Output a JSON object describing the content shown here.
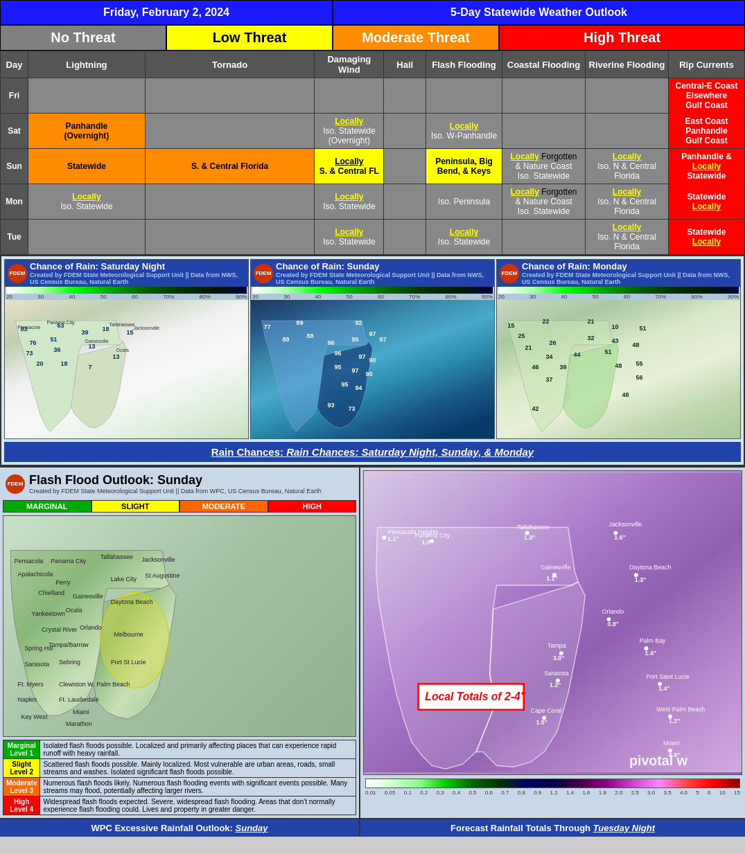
{
  "header": {
    "date": "Friday, February 2, 2024",
    "outlook": "5-Day Statewide Weather Outlook"
  },
  "threats": {
    "no_threat": "No Threat",
    "low_threat": "Low Threat",
    "moderate_threat": "Moderate Threat",
    "high_threat": "High Threat"
  },
  "columns": {
    "day": "Day",
    "lightning": "Lightning",
    "tornado": "Tornado",
    "damaging_wind": "Damaging Wind",
    "hail": "Hail",
    "flash_flooding": "Flash Flooding",
    "coastal_flooding": "Coastal Flooding",
    "riverine_flooding": "Riverine Flooding",
    "rip_currents": "Rip Currents"
  },
  "rows": [
    {
      "day": "Fri",
      "lightning": "",
      "tornado": "",
      "damaging_wind": "",
      "hail": "",
      "flash_flooding": "",
      "coastal_flooding": "",
      "riverine_flooding": "",
      "rip_currents_line1": "Central-E Coast",
      "rip_currents_line2": "Elsewhere",
      "rip_currents_line3": "Gulf Coast",
      "rip_type": "red"
    },
    {
      "day": "Sat",
      "lightning_locally": "Panhandle (Overnight)",
      "lightning_type": "orange",
      "tornado": "",
      "damaging_wind_locally": "Locally",
      "damaging_wind_sub": "Iso. Statewide (Overnight)",
      "hail": "",
      "flash_locally": "Locally",
      "flash_sub": "Iso. W-Panhandle",
      "coastal_flooding": "",
      "riverine_flooding": "",
      "rip_currents_line1": "East Coast",
      "rip_currents_line2": "Panhandle",
      "rip_currents_line3": "Gulf Coast",
      "rip_type": "red"
    },
    {
      "day": "Sun",
      "lightning": "Statewide",
      "lightning_type": "orange",
      "tornado_locally": "S. & Central Florida",
      "tornado_type": "orange",
      "damaging_wind_locally": "Locally",
      "damaging_wind_sub": "S. & Central FL",
      "hail": "",
      "flash_flooding": "Peninsula, Big Bend, & Keys",
      "flash_type": "yellow",
      "coastal_locally": "Locally Forgotten & Nature Coast",
      "coastal_sub": "Iso. Statewide",
      "riverine_locally": "Locally",
      "riverine_sub": "Iso. N & Central Florida",
      "rip_currents_line1": "Panhandle &",
      "rip_currents_line2": "Locally",
      "rip_currents_line3": "Statewide",
      "rip_type": "red"
    },
    {
      "day": "Mon",
      "lightning_locally": "Locally",
      "lightning_sub": "Iso. Statewide",
      "lightning_type": "yellow",
      "tornado": "",
      "damaging_wind_locally": "Locally",
      "damaging_wind_sub": "Iso. Statewide",
      "hail": "",
      "flash_flooding": "Iso. Peninsula",
      "flash_type": "gray",
      "coastal_locally": "Locally Forgotten & Nature Coast",
      "coastal_sub": "Iso. Statewide",
      "riverine_locally": "Locally",
      "riverine_sub": "Iso. N & Central Florida",
      "rip_currents_line1": "Statewide",
      "rip_currents_line2": "Locally",
      "rip_type": "red"
    },
    {
      "day": "Tue",
      "lightning": "",
      "tornado": "",
      "damaging_wind_locally": "Locally",
      "damaging_wind_sub": "Iso. Statewide",
      "hail": "",
      "flash_locally": "Locally",
      "flash_sub": "Iso. Statewide",
      "coastal_flooding": "",
      "riverine_locally": "Locally",
      "riverine_sub": "Iso. N & Central Florida",
      "rip_currents_line1": "Statewide",
      "rip_currents_line2": "Locally",
      "rip_type": "red"
    }
  ],
  "maps": {
    "rain_saturday_title": "Chance of Rain: Saturday Night",
    "rain_sunday_title": "Chance of Rain: Sunday",
    "rain_monday_title": "Chance of Rain: Monday",
    "created_by": "Created by FDEM State Meteorological Support Unit || Data from NWS, US Census Bureau, Natural Earth",
    "caption": "Rain Chances: Saturday Night, Sunday, & Monday"
  },
  "flood_outlook": {
    "title": "Flash Flood Outlook: Sunday",
    "created_by": "Created by FDEM State Meteorological Support Unit || Data from WPC, US Census Bureau, Natural Earth",
    "legend": {
      "marginal": "MARGINAL",
      "slight": "SLIGHT",
      "moderate": "MODERATE",
      "high": "HIGH"
    },
    "levels": [
      {
        "level": "Marginal",
        "number": "Level 1",
        "description": "Isolated flash floods possible. Localized and primarily affecting places that can experience rapid runoff with heavy rainfall."
      },
      {
        "level": "Slight",
        "number": "Level 2",
        "description": "Scattered flash floods possible. Mainly localized. Most vulnerable are urban areas, roads, small streams and washes. Isolated significant flash floods possible."
      },
      {
        "level": "Moderate",
        "number": "Level 3",
        "description": "Numerous flash floods likely. Numerous flash flooding events with significant events possible. Many streams may flood, potentially affecting larger rivers."
      },
      {
        "level": "High",
        "number": "Level 4",
        "description": "Widespread flash floods expected. Severe, widespread flash flooding. Areas that don't normally experience flash flooding could. Lives and property in greater danger."
      }
    ]
  },
  "rainfall_map": {
    "local_totals": "Local Totals of 2-4\"",
    "watermark": "pivotal w",
    "locations": [
      {
        "name": "Pensacola Heights",
        "value": "1.1\""
      },
      {
        "name": "Panama City",
        "value": "1.0\""
      },
      {
        "name": "Tallahassee",
        "value": "1.3\""
      },
      {
        "name": "Jacksonville",
        "value": "1.6\""
      },
      {
        "name": "Gainesville",
        "value": "1.1\""
      },
      {
        "name": "Daytona Beach",
        "value": "1.3\""
      },
      {
        "name": "Orlando",
        "value": "0.8\""
      },
      {
        "name": "Tampa",
        "value": "3.0\""
      },
      {
        "name": "Palm Bay",
        "value": "1.4\""
      },
      {
        "name": "Sarasota",
        "value": "1.2\""
      },
      {
        "name": "Port Saint Lucie",
        "value": "1.4\""
      },
      {
        "name": "Cape Coral",
        "value": "1.5\""
      },
      {
        "name": "West Palm Beach",
        "value": "1.2\""
      },
      {
        "name": "Miami",
        "value": "0.9\""
      }
    ]
  },
  "bottom_captions": {
    "left": "WPC Excessive Rainfall Outlook: Sunday",
    "left_italic": "Sunday",
    "right": "Forecast Rainfall Totals Through Tuesday Night",
    "right_italic": "Tuesday Night"
  },
  "saturday_numbers": [
    "83",
    "63",
    "76",
    "51",
    "73",
    "39",
    "18",
    "15",
    "36",
    "13",
    "20",
    "18",
    "7",
    "13"
  ],
  "sunday_numbers": [
    "77",
    "89",
    "92",
    "88",
    "88",
    "96",
    "95",
    "97",
    "97",
    "96",
    "90",
    "97",
    "95",
    "90",
    "95",
    "94",
    "93",
    "73"
  ],
  "monday_numbers": [
    "15",
    "22",
    "21",
    "25",
    "10",
    "51",
    "21",
    "26",
    "32",
    "43",
    "48",
    "34",
    "44",
    "51",
    "46",
    "39",
    "48",
    "55",
    "37",
    "56",
    "42",
    "48"
  ]
}
